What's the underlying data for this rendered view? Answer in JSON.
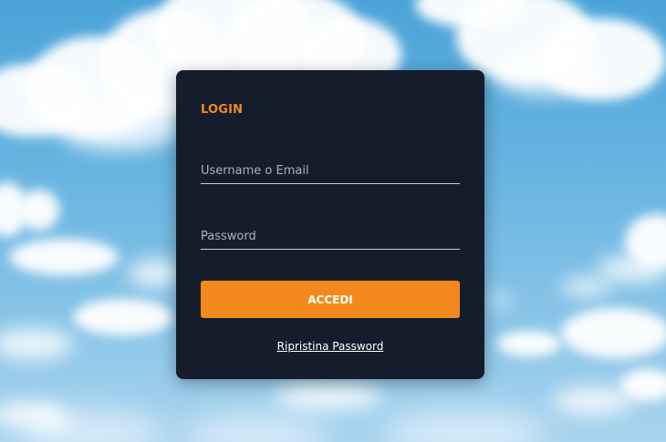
{
  "login": {
    "title": "LOGIN",
    "username_placeholder": "Username o Email",
    "password_placeholder": "Password",
    "submit_label": "ACCEDI",
    "reset_link": "Ripristina Password"
  },
  "colors": {
    "accent": "#f3891c",
    "card_background": "#151d2c",
    "sky": "#5aaee0"
  }
}
